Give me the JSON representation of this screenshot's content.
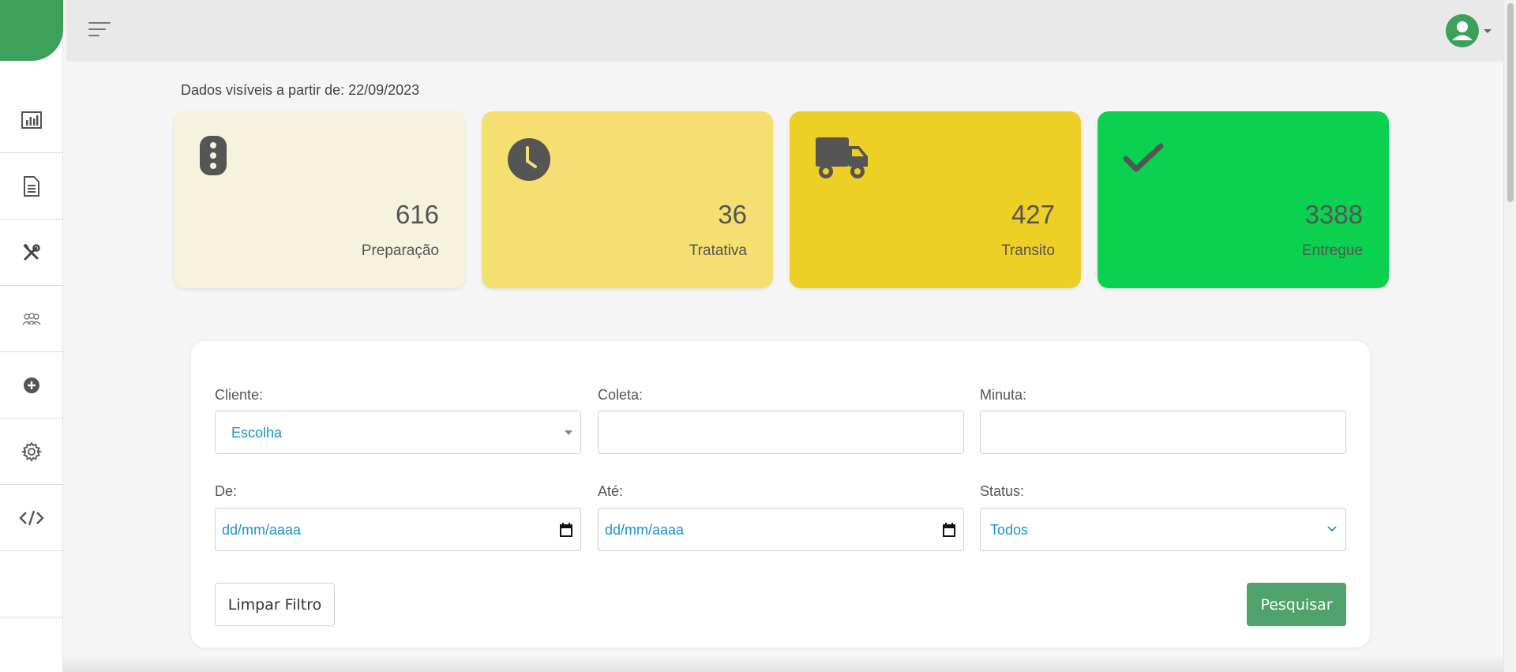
{
  "sidebar": {
    "items": [
      {
        "icon": "bar-chart-icon"
      },
      {
        "icon": "document-icon"
      },
      {
        "icon": "tools-icon"
      },
      {
        "icon": "users-icon"
      },
      {
        "icon": "plus-circle-icon"
      },
      {
        "icon": "gear-icon"
      },
      {
        "icon": "code-icon"
      }
    ]
  },
  "header": {
    "menu_icon": "hamburger-icon",
    "user_icon": "user-avatar-icon"
  },
  "summary": {
    "date_text": "Dados visíveis a partir de: 22/09/2023",
    "cards": [
      {
        "value": "616",
        "label": "Preparação",
        "icon": "traffic-light-icon",
        "color": "#f5f3dd"
      },
      {
        "value": "36",
        "label": "Tratativa",
        "icon": "clock-icon",
        "color": "#f4df70"
      },
      {
        "value": "427",
        "label": "Transito",
        "icon": "truck-icon",
        "color": "#edcf25"
      },
      {
        "value": "3388",
        "label": "Entregue",
        "icon": "check-icon",
        "color": "#0ad150"
      }
    ]
  },
  "filters": {
    "cliente_label": "Cliente:",
    "cliente_value": "Escolha",
    "coleta_label": "Coleta:",
    "coleta_value": "",
    "minuta_label": "Minuta:",
    "minuta_value": "",
    "de_label": "De:",
    "de_value": "dd/mm/aaaa",
    "ate_label": "Até:",
    "ate_value": "dd/mm/aaaa",
    "status_label": "Status:",
    "status_value": "Todos",
    "clear_button": "Limpar Filtro",
    "search_button": "Pesquisar"
  },
  "colors": {
    "brand_green": "#3da05a",
    "search_button": "#4fa36a",
    "link_blue": "#1e90d6"
  }
}
